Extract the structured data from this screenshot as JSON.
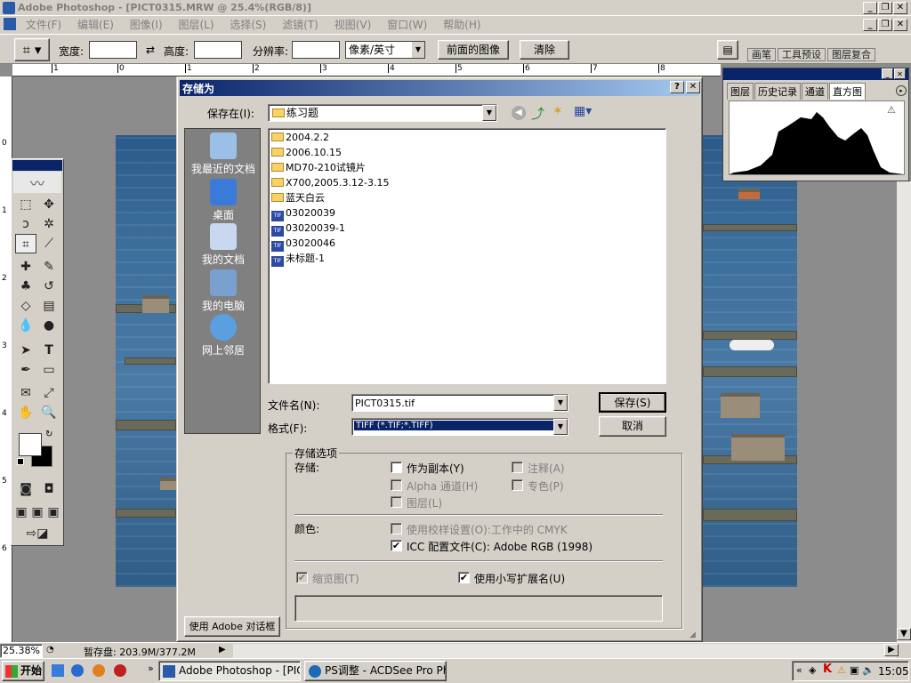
{
  "app": {
    "title": "Adobe Photoshop - [PICT0315.MRW @ 25.4%(RGB/8)]"
  },
  "menu": [
    "文件(F)",
    "编辑(E)",
    "图像(I)",
    "图层(L)",
    "选择(S)",
    "滤镜(T)",
    "视图(V)",
    "窗口(W)",
    "帮助(H)"
  ],
  "options": {
    "width_label": "宽度:",
    "height_label": "高度:",
    "resolution_label": "分辨率:",
    "unit": "像素/英寸",
    "front_image": "前面的图像",
    "clear": "清除",
    "palette_tabs": [
      "画笔",
      "工具预设",
      "图层复合"
    ]
  },
  "ruler": {
    "top_ticks": [
      "1",
      "0",
      "1",
      "2",
      "3",
      "4",
      "5",
      "6",
      "7",
      "8"
    ],
    "left_ticks": [
      "0",
      "1",
      "2",
      "3",
      "4",
      "5",
      "6"
    ]
  },
  "histogram": {
    "tabs": [
      "图层",
      "历史记录",
      "通道",
      "直方图"
    ]
  },
  "dialog": {
    "title": "存储为",
    "save_in_label": "保存在(I):",
    "save_in_value": "练习题",
    "places": [
      "我最近的文档",
      "桌面",
      "我的文档",
      "我的电脑",
      "网上邻居"
    ],
    "files": [
      {
        "name": "2004.2.2",
        "type": "folder"
      },
      {
        "name": "2006.10.15",
        "type": "folder"
      },
      {
        "name": "MD70-210试镜片",
        "type": "folder"
      },
      {
        "name": "X700,2005.3.12-3.15",
        "type": "folder"
      },
      {
        "name": "蓝天白云",
        "type": "folder"
      },
      {
        "name": "03020039",
        "type": "tif"
      },
      {
        "name": "03020039-1",
        "type": "tif"
      },
      {
        "name": "03020046",
        "type": "tif"
      },
      {
        "name": "未标题-1",
        "type": "tif"
      }
    ],
    "filename_label": "文件名(N):",
    "filename_value": "PICT0315.tif",
    "format_label": "格式(F):",
    "format_value": "TIFF (*.TIF;*.TIFF)",
    "save_button": "保存(S)",
    "cancel_button": "取消",
    "options_group": "存储选项",
    "store_label": "存储:",
    "as_copy": "作为副本(Y)",
    "annotations": "注释(A)",
    "alpha_channels": "Alpha 通道(H)",
    "spot_colors": "专色(P)",
    "layers": "图层(L)",
    "color_label": "颜色:",
    "proof_setup": "使用校样设置(O):工作中的 CMYK",
    "icc_profile": "ICC 配置文件(C): Adobe RGB (1998)",
    "thumbnail": "缩览图(T)",
    "lowercase_ext": "使用小写扩展名(U)",
    "use_adobe_dialog": "使用 Adobe 对话框"
  },
  "status": {
    "zoom": "25.38%",
    "scratch": "暂存盘: 203.9M/377.2M"
  },
  "taskbar": {
    "start": "开始",
    "tasks": [
      "Adobe Photoshop - [PIC...",
      "PS调整 - ACDSee Pro Ph..."
    ],
    "clock": "15:05"
  }
}
